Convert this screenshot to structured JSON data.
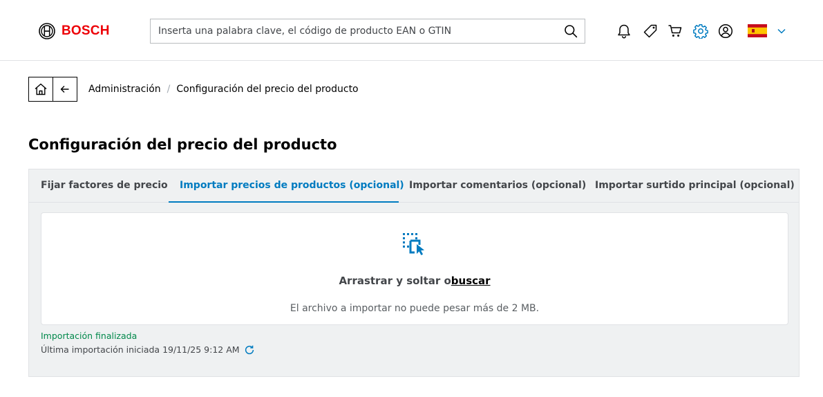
{
  "header": {
    "brand": "BOSCH",
    "search_placeholder": "Inserta una palabra clave, el código de producto EAN o GTIN",
    "search_value": "",
    "icons": [
      "bell-icon",
      "tag-icon",
      "cart-icon",
      "gear-icon",
      "user-icon",
      "spain-flag-icon",
      "chevron-down-icon"
    ],
    "accent_color": "#007bc0",
    "brand_color": "#ed0007"
  },
  "breadcrumb": {
    "items": [
      "Administración",
      "Configuración del precio del producto"
    ],
    "separator": "/"
  },
  "page": {
    "title": "Configuración del precio del producto"
  },
  "tabs": [
    {
      "label": "Fijar factores de precio",
      "active": false
    },
    {
      "label": "Importar precios de productos (opcional)",
      "active": true
    },
    {
      "label": "Importar comentarios (opcional)",
      "active": false
    },
    {
      "label": "Importar surtido principal (opcional)",
      "active": false
    }
  ],
  "dropzone": {
    "text": "Arrastrar y soltar o",
    "link": "buscar",
    "hint": "El archivo a importar no puede pesar más de 2 MB."
  },
  "import_status": {
    "status": "Importación finalizada",
    "last_import": "Última importación iniciada 19/11/25 9:12 AM",
    "status_color": "#00884a"
  }
}
